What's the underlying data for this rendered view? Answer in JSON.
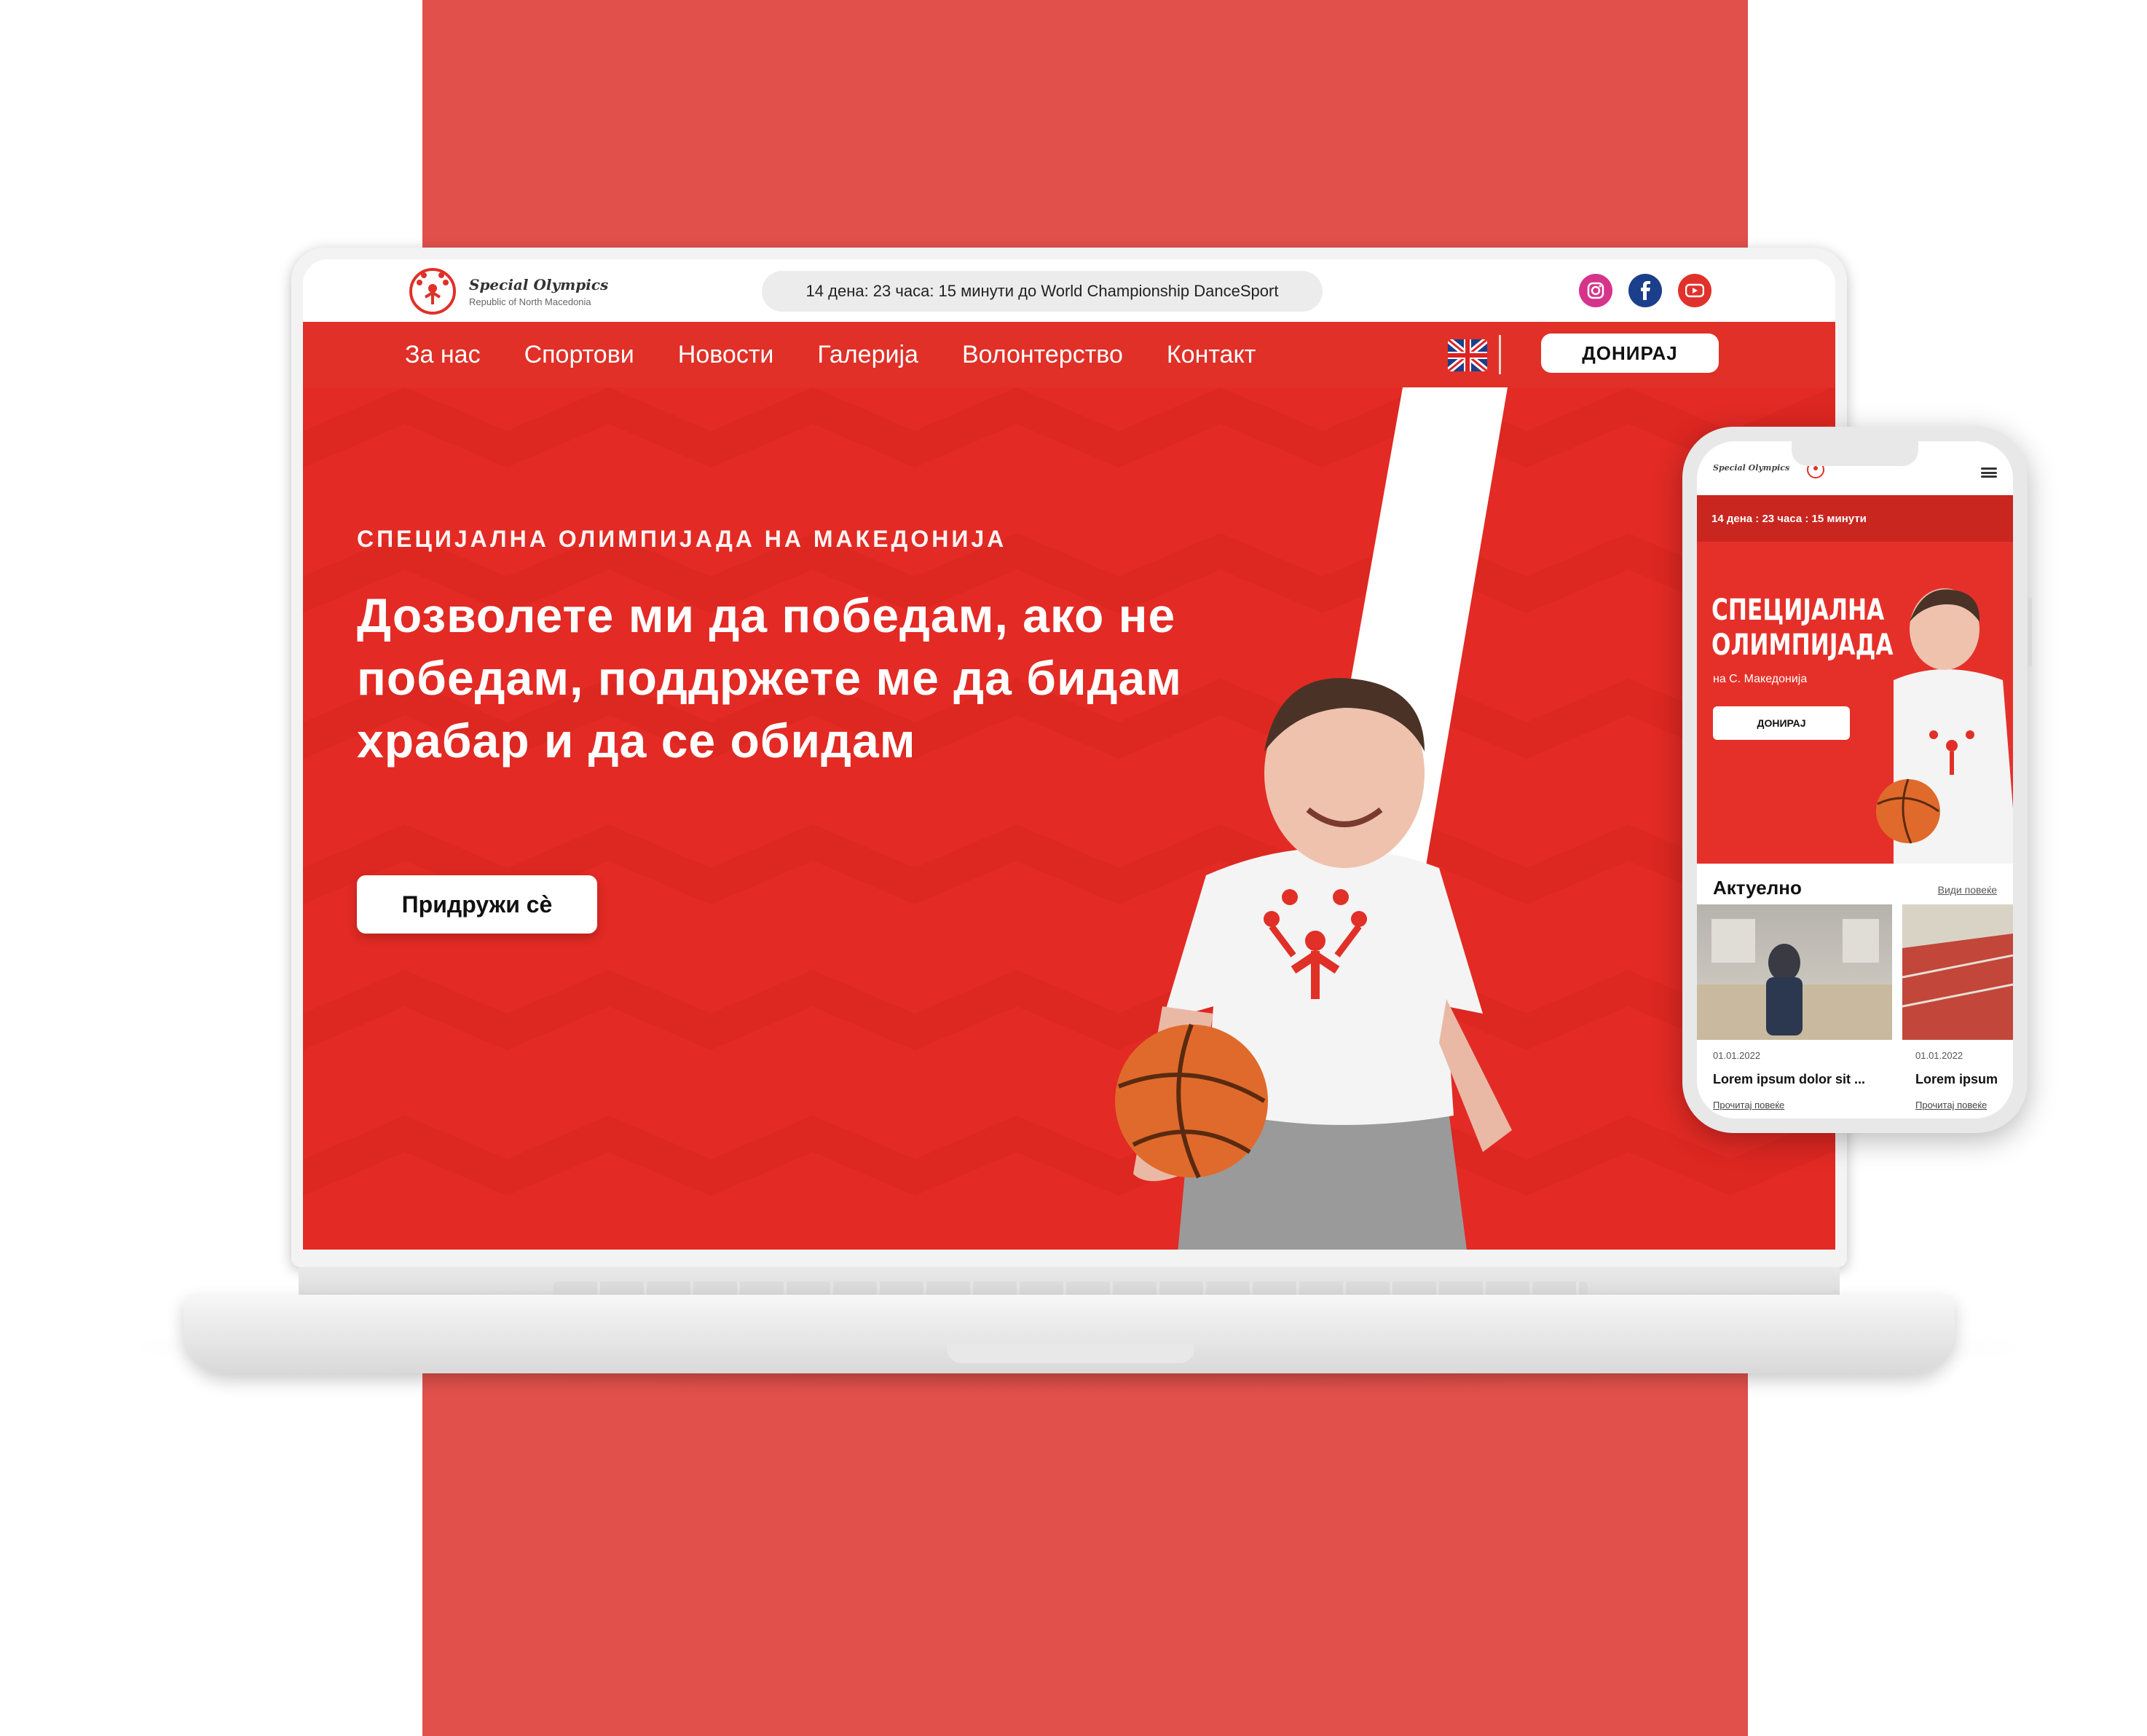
{
  "colors": {
    "brand_red": "#e03027",
    "background_band": "#e2504b",
    "white": "#ffffff"
  },
  "laptop": {
    "topbar": {
      "logo_title": "Special Olympics",
      "logo_subtitle": "Republic of North Macedonia",
      "countdown": "14 дена: 23 часа: 15 минути до World Championship DanceSport",
      "social_icons": [
        "instagram-icon",
        "facebook-icon",
        "youtube-icon"
      ]
    },
    "nav": {
      "items": [
        {
          "label": "За нас"
        },
        {
          "label": "Спортови"
        },
        {
          "label": "Новости"
        },
        {
          "label": "Галерија"
        },
        {
          "label": "Волонтерство"
        },
        {
          "label": "Контакт"
        }
      ],
      "language_icon": "uk-flag-icon",
      "donate_label": "ДОНИРАЈ"
    },
    "hero": {
      "eyebrow": "СПЕЦИЈАЛНА ОЛИМПИЈАДА НА МАКЕДОНИЈА",
      "headline": "Дозволете ми да победам, ако не победам, поддржете ме да бидам храбар и да се обидам",
      "cta_label": "Придружи сѐ"
    }
  },
  "phone": {
    "logo_title": "Special Olympics",
    "countdown": "14 дена : 23 часа : 15 минути",
    "hero_title": "СПЕЦИЈАЛНА ОЛИМПИЈАДА",
    "hero_subtitle": "на С. Македонија",
    "donate_label": "ДОНИРАЈ",
    "news": {
      "title": "Актуелно",
      "more_link": "Види повеќе",
      "cards": [
        {
          "date": "01.01.2022",
          "title": "Lorem ipsum dolor sit ...",
          "link": "Прочитај повеќе"
        },
        {
          "date": "01.01.2022",
          "title": "Lorem ipsum",
          "link": "Прочитај повеќе"
        }
      ]
    }
  }
}
